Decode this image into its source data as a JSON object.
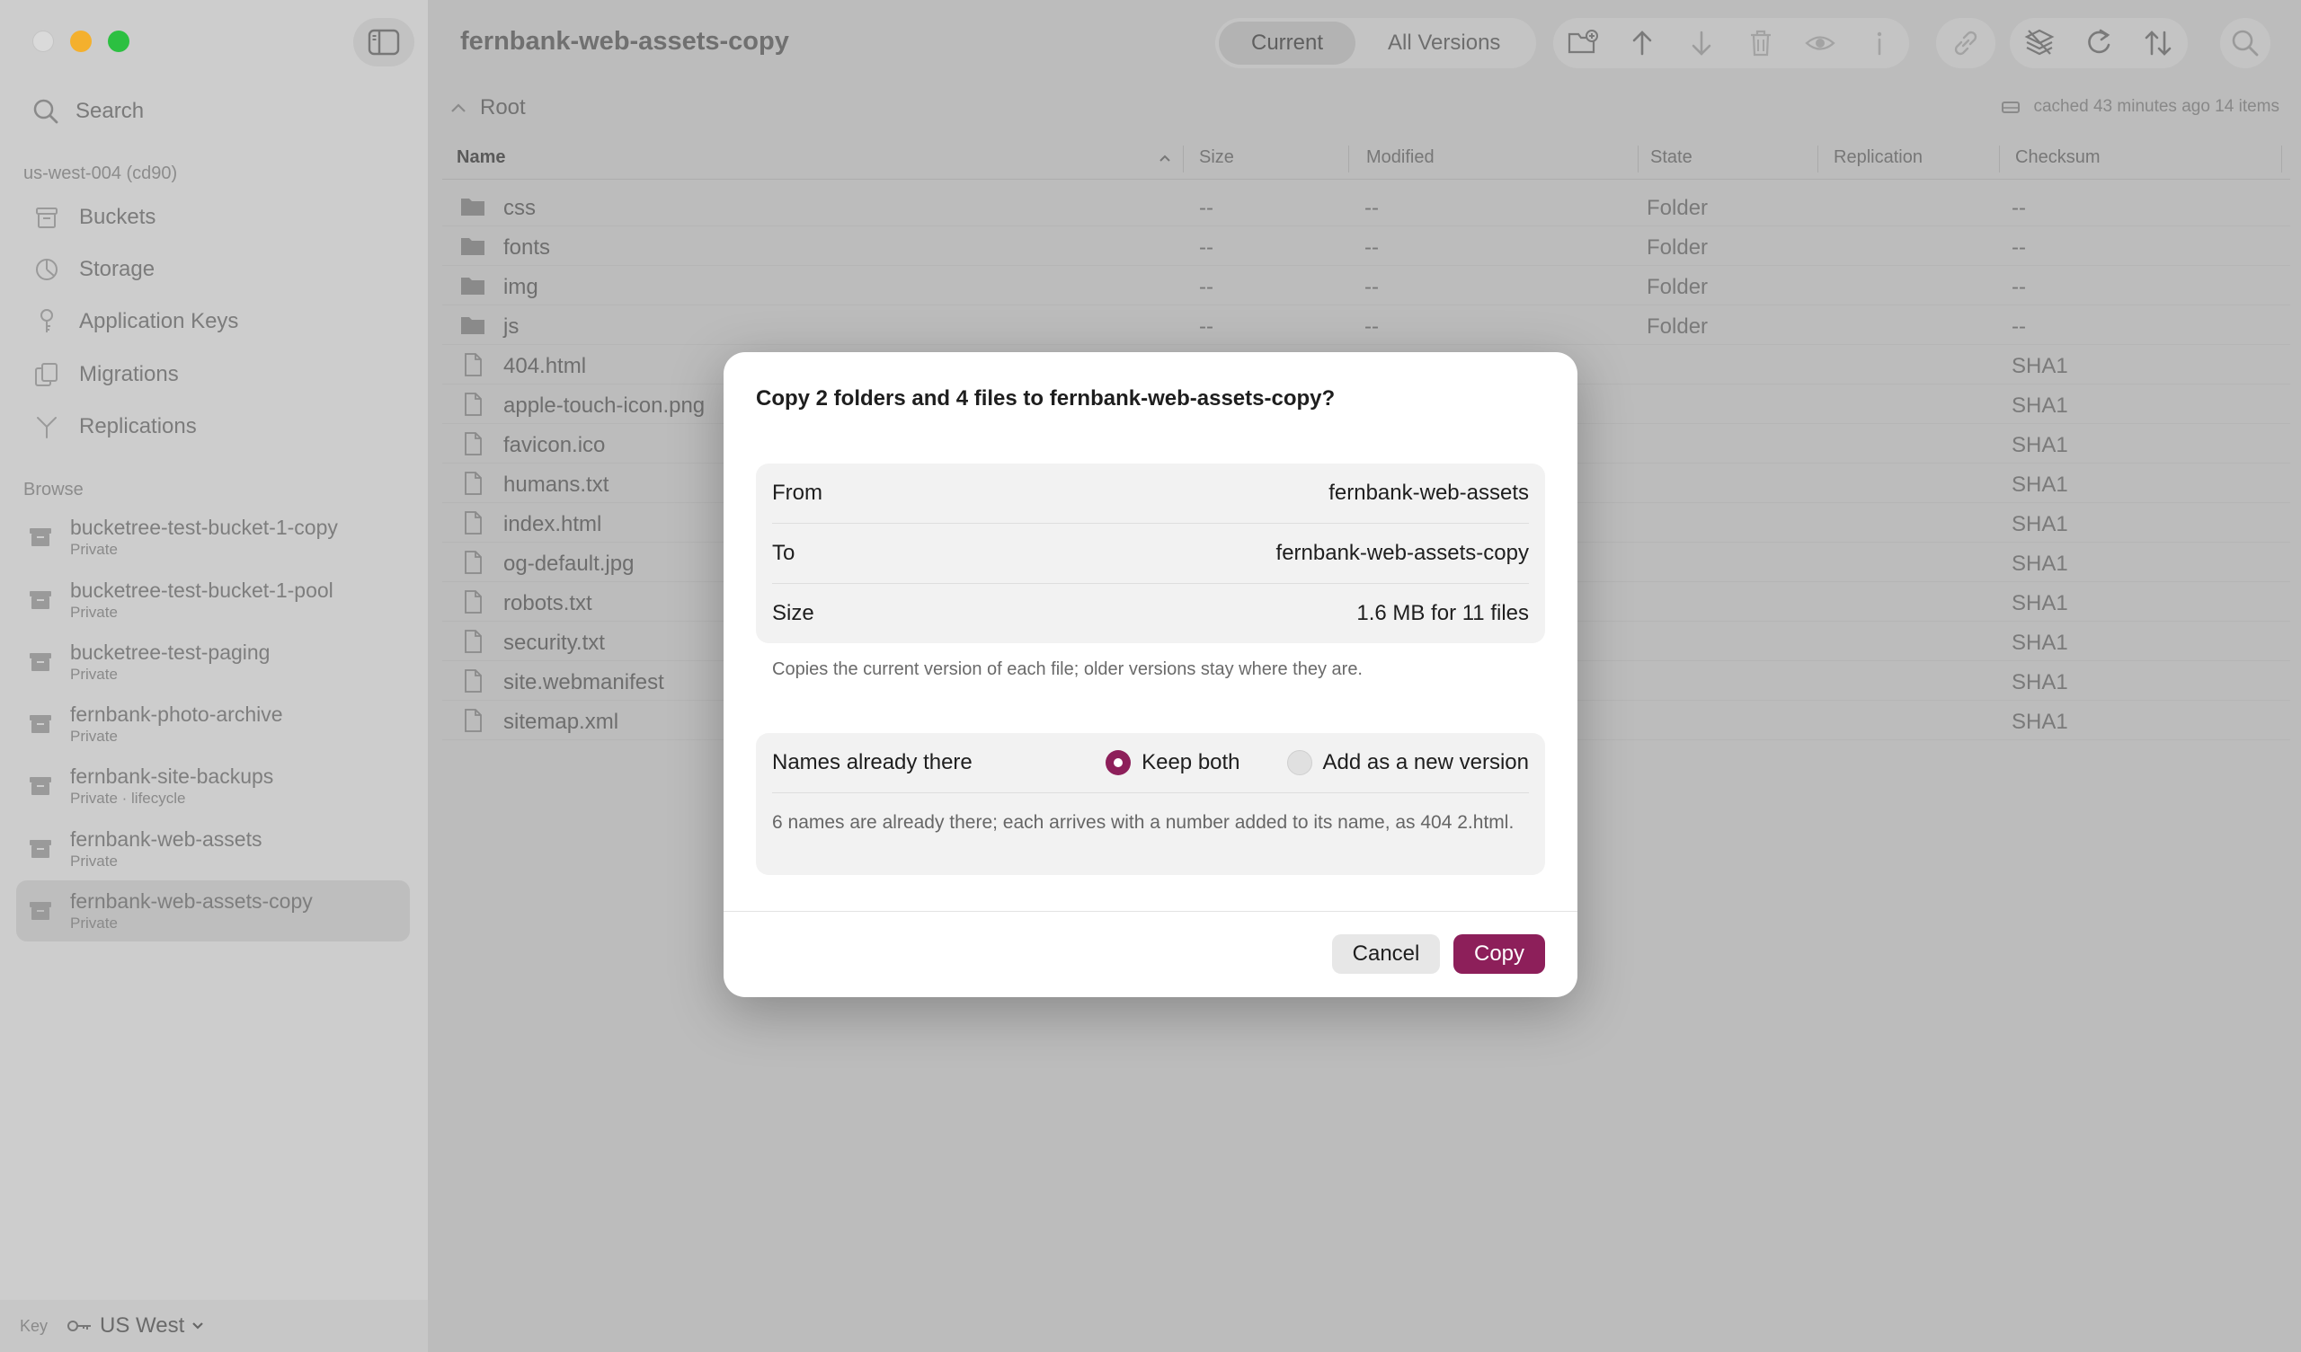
{
  "sidebar": {
    "search_label": "Search",
    "account_heading": "us-west-004 (cd90)",
    "nav": [
      {
        "label": "Buckets",
        "icon": "bucket-icon"
      },
      {
        "label": "Storage",
        "icon": "pie-chart-icon"
      },
      {
        "label": "Application Keys",
        "icon": "key-icon"
      },
      {
        "label": "Migrations",
        "icon": "migrate-icon"
      },
      {
        "label": "Replications",
        "icon": "branch-icon"
      }
    ],
    "browse_heading": "Browse",
    "buckets": [
      {
        "name": "bucketree-test-bucket-1-copy",
        "sub": "Private"
      },
      {
        "name": "bucketree-test-bucket-1-pool",
        "sub": "Private"
      },
      {
        "name": "bucketree-test-paging",
        "sub": "Private"
      },
      {
        "name": "fernbank-photo-archive",
        "sub": "Private"
      },
      {
        "name": "fernbank-site-backups",
        "sub": "Private · lifecycle"
      },
      {
        "name": "fernbank-web-assets",
        "sub": "Private"
      },
      {
        "name": "fernbank-web-assets-copy",
        "sub": "Private"
      }
    ],
    "footer_key_label": "Key",
    "footer_region": "US West"
  },
  "toolbar": {
    "title": "fernbank-web-assets-copy",
    "seg_current": "Current",
    "seg_all_versions": "All Versions"
  },
  "breadcrumb": {
    "root": "Root"
  },
  "cache_info": "cached 43 minutes ago 14 items",
  "table": {
    "headers": {
      "name": "Name",
      "size": "Size",
      "modified": "Modified",
      "state": "State",
      "replication": "Replication",
      "checksum": "Checksum"
    },
    "rows": [
      {
        "name": "css",
        "type": "folder",
        "size": "--",
        "modified": "--",
        "state": "Folder",
        "checksum": "--"
      },
      {
        "name": "fonts",
        "type": "folder",
        "size": "--",
        "modified": "--",
        "state": "Folder",
        "checksum": "--"
      },
      {
        "name": "img",
        "type": "folder",
        "size": "--",
        "modified": "--",
        "state": "Folder",
        "checksum": "--"
      },
      {
        "name": "js",
        "type": "folder",
        "size": "--",
        "modified": "--",
        "state": "Folder",
        "checksum": "--"
      },
      {
        "name": "404.html",
        "type": "file",
        "checksum": "SHA1"
      },
      {
        "name": "apple-touch-icon.png",
        "type": "file",
        "checksum": "SHA1"
      },
      {
        "name": "favicon.ico",
        "type": "file",
        "checksum": "SHA1"
      },
      {
        "name": "humans.txt",
        "type": "file",
        "checksum": "SHA1"
      },
      {
        "name": "index.html",
        "type": "file",
        "checksum": "SHA1"
      },
      {
        "name": "og-default.jpg",
        "type": "file",
        "checksum": "SHA1"
      },
      {
        "name": "robots.txt",
        "type": "file",
        "checksum": "SHA1"
      },
      {
        "name": "security.txt",
        "type": "file",
        "checksum": "SHA1"
      },
      {
        "name": "site.webmanifest",
        "type": "file",
        "checksum": "SHA1"
      },
      {
        "name": "sitemap.xml",
        "type": "file",
        "checksum": "SHA1"
      }
    ]
  },
  "dialog": {
    "title": "Copy 2 folders and 4 files to fernbank-web-assets-copy?",
    "from_label": "From",
    "from_value": "fernbank-web-assets",
    "to_label": "To",
    "to_value": "fernbank-web-assets-copy",
    "size_label": "Size",
    "size_value": "1.6 MB for 11 files",
    "note": "Copies the current version of each file; older versions stay where they are.",
    "names_label": "Names already there",
    "option_keep_both": "Keep both",
    "option_new_version": "Add as a new version",
    "selected_option": "keep_both",
    "names_note": "6 names are already there; each arrives with a number added to its name, as 404 2.html.",
    "cancel_label": "Cancel",
    "copy_label": "Copy",
    "accent_color": "#8d1f5a"
  }
}
